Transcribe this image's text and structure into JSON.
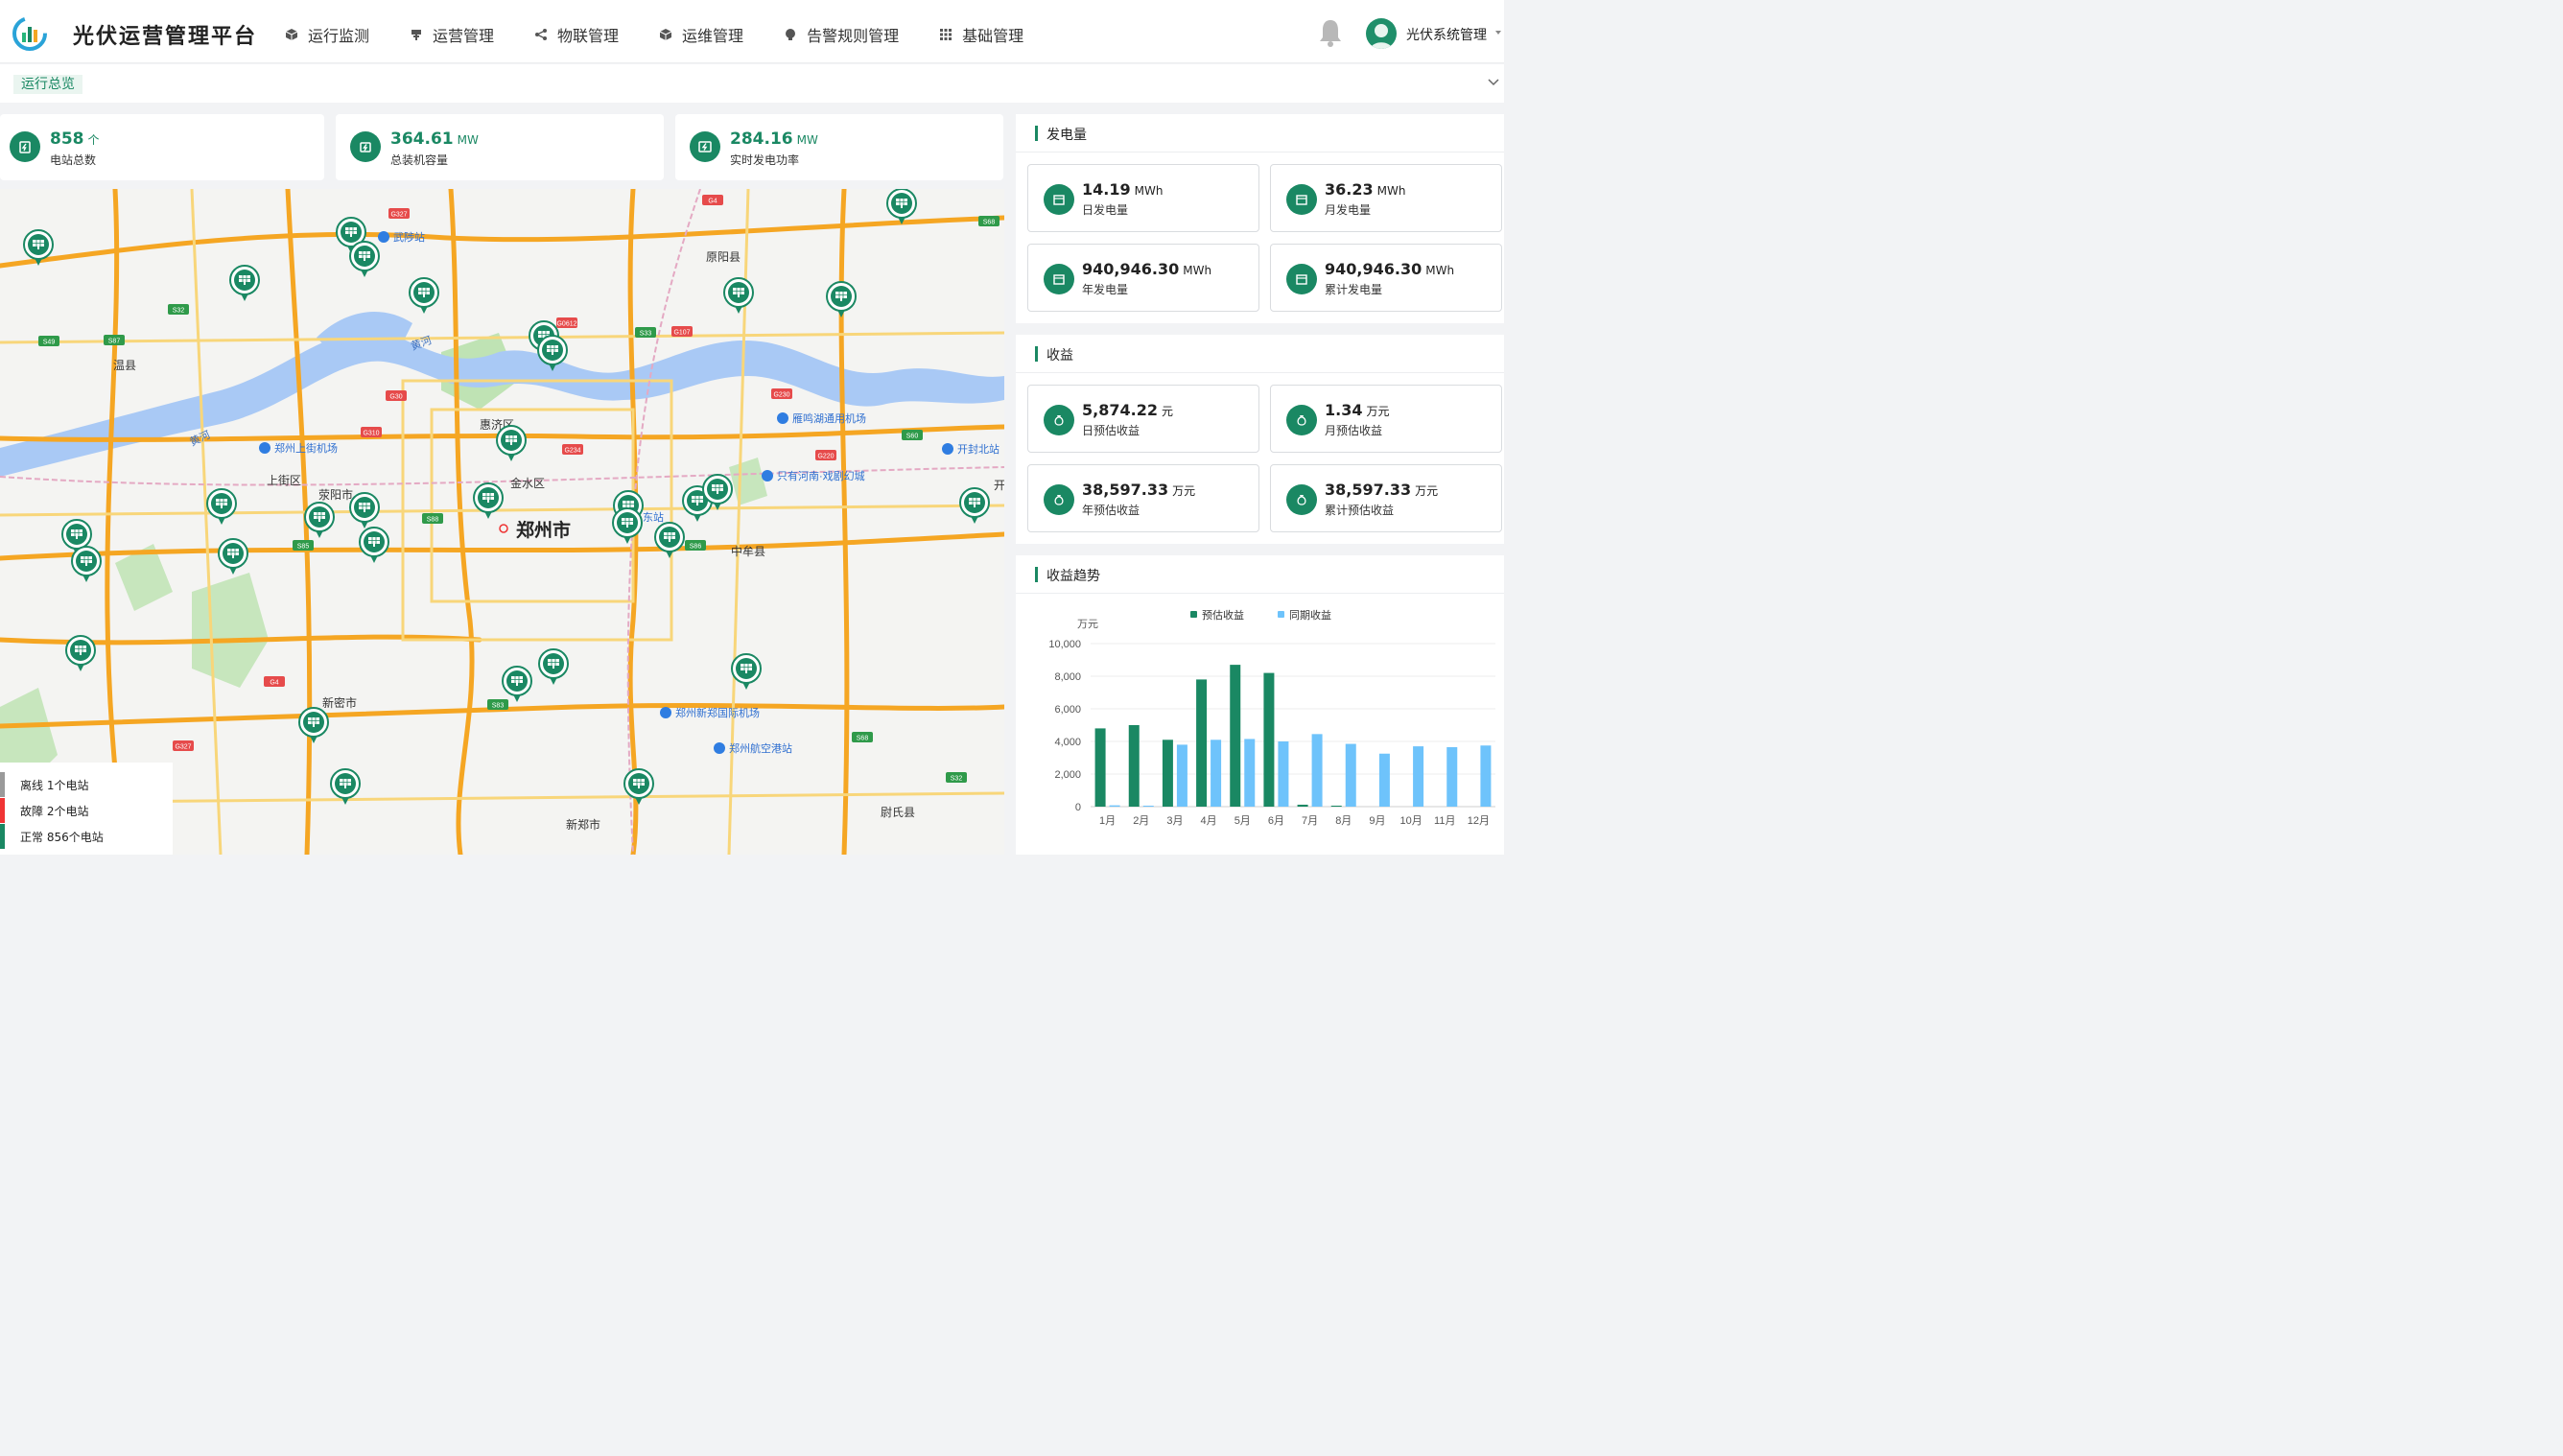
{
  "app": {
    "title": "光伏运营管理平台"
  },
  "nav": [
    {
      "label": "运行监测",
      "icon": "cube-icon"
    },
    {
      "label": "运营管理",
      "icon": "signpost-icon"
    },
    {
      "label": "物联管理",
      "icon": "share-icon"
    },
    {
      "label": "运维管理",
      "icon": "cube-icon"
    },
    {
      "label": "告警规则管理",
      "icon": "bulb-icon"
    },
    {
      "label": "基础管理",
      "icon": "grid-icon"
    }
  ],
  "user": {
    "name": "光伏系统管理"
  },
  "tabs": {
    "active": "运行总览"
  },
  "stats": [
    {
      "value": "858",
      "unit": "个",
      "label": "电站总数",
      "icon": "station-icon"
    },
    {
      "value": "364.61",
      "unit": "MW",
      "label": "总装机容量",
      "icon": "capacity-icon"
    },
    {
      "value": "284.16",
      "unit": "MW",
      "label": "实时发电功率",
      "icon": "power-icon"
    }
  ],
  "colors": {
    "accent": "#1a8863",
    "series2": "#6ec3fb",
    "offline": "#9a9a9a",
    "fault": "#f03434",
    "normal": "#1a8863"
  },
  "map": {
    "city": "郑州市",
    "places": [
      "原阳县",
      "温县",
      "上街区",
      "荥阳市",
      "金水区",
      "惠济区",
      "中牟县",
      "新密市",
      "新郑市",
      "尉氏县",
      "开"
    ],
    "pois": [
      "武陟站",
      "郑州上街机场",
      "雁鸣湖通用机场",
      "开封北站",
      "只有河南·戏剧幻城",
      "东站",
      "郑州新郑国际机场",
      "郑州航空港站"
    ],
    "river": "黄河",
    "roads": [
      "G327",
      "G4",
      "S68",
      "S32",
      "S49",
      "S87",
      "G30",
      "G0612",
      "S33",
      "G107",
      "G310",
      "G234",
      "G220",
      "G230",
      "S88",
      "S85",
      "S86",
      "S60",
      "S83"
    ]
  },
  "legend": [
    {
      "label": "离线",
      "count": "1个电站"
    },
    {
      "label": "故障",
      "count": "2个电站"
    },
    {
      "label": "正常",
      "count": "856个电站"
    }
  ],
  "generation": {
    "title": "发电量",
    "items": [
      {
        "value": "14.19",
        "unit": "MWh",
        "label": "日发电量"
      },
      {
        "value": "36.23",
        "unit": "MWh",
        "label": "月发电量"
      },
      {
        "value": "940,946.30",
        "unit": "MWh",
        "label": "年发电量"
      },
      {
        "value": "940,946.30",
        "unit": "MWh",
        "label": "累计发电量"
      }
    ]
  },
  "revenue": {
    "title": "收益",
    "items": [
      {
        "value": "5,874.22",
        "unit": "元",
        "label": "日预估收益"
      },
      {
        "value": "1.34",
        "unit": "万元",
        "label": "月预估收益"
      },
      {
        "value": "38,597.33",
        "unit": "万元",
        "label": "年预估收益"
      },
      {
        "value": "38,597.33",
        "unit": "万元",
        "label": "累计预估收益"
      }
    ]
  },
  "trend": {
    "title": "收益趋势"
  },
  "chart_data": {
    "type": "bar",
    "title": "",
    "ylabel": "万元",
    "ylim": [
      0,
      10000
    ],
    "yticks": [
      "0",
      "2,000",
      "4,000",
      "6,000",
      "8,000",
      "10,000"
    ],
    "categories": [
      "1月",
      "2月",
      "3月",
      "4月",
      "5月",
      "6月",
      "7月",
      "8月",
      "9月",
      "10月",
      "11月",
      "12月"
    ],
    "legend_position": "top",
    "series": [
      {
        "name": "预估收益",
        "values": [
          4800,
          5000,
          4100,
          7800,
          8700,
          8200,
          120,
          60,
          0,
          0,
          0,
          0
        ]
      },
      {
        "name": "同期收益",
        "values": [
          80,
          60,
          3800,
          4100,
          4150,
          4000,
          4450,
          3850,
          3250,
          3700,
          3650,
          3750
        ]
      }
    ]
  }
}
